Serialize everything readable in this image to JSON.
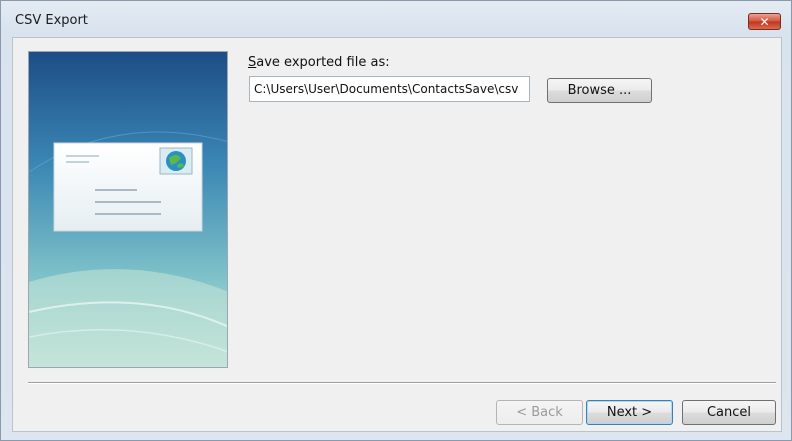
{
  "window": {
    "title": "CSV Export",
    "close_symbol": "✕"
  },
  "form": {
    "label_accesskey": "S",
    "label_rest": "ave exported file as:",
    "path_value": "C:\\Users\\User\\Documents\\ContactsSave\\csv"
  },
  "buttons": {
    "browse": "Browse ...",
    "back": "< Back",
    "next": "Next >",
    "cancel": "Cancel"
  },
  "icons": {
    "close": "close-icon",
    "side_illustration": "envelope-icon",
    "stamp": "globe-stamp-icon"
  },
  "colors": {
    "accent": "#3c7fb1",
    "close_button": "#c0371f",
    "side_panel_top": "#1f4f86"
  }
}
